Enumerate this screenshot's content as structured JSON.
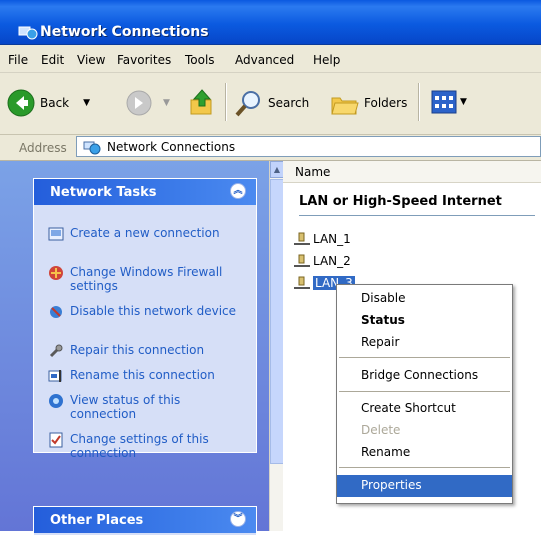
{
  "window": {
    "title": "Network Connections"
  },
  "menu": [
    "File",
    "Edit",
    "View",
    "Favorites",
    "Tools",
    "Advanced",
    "Help"
  ],
  "toolbar": {
    "back": "Back",
    "search": "Search",
    "folders": "Folders"
  },
  "address": {
    "label": "Address",
    "value": "Network Connections"
  },
  "tasks_panel": {
    "title": "Network Tasks",
    "items": [
      {
        "label": "Create a new connection",
        "icon": "new-connection-icon"
      },
      {
        "label": "Change Windows Firewall settings",
        "icon": "firewall-icon"
      },
      {
        "label": "Disable this network device",
        "icon": "disable-device-icon"
      },
      {
        "label": "Repair this connection",
        "icon": "repair-icon"
      },
      {
        "label": "Rename this connection",
        "icon": "rename-icon"
      },
      {
        "label": "View status of this connection",
        "icon": "status-icon"
      },
      {
        "label": "Change settings of this connection",
        "icon": "settings-icon"
      }
    ]
  },
  "places_panel": {
    "title": "Other Places"
  },
  "content": {
    "column_name": "Name",
    "group_title": "LAN or High-Speed Internet",
    "items": [
      {
        "label": "LAN_1",
        "selected": false
      },
      {
        "label": "LAN_2",
        "selected": false
      },
      {
        "label": "LAN_3",
        "selected": true
      }
    ]
  },
  "context_menu": {
    "disable": "Disable",
    "status": "Status",
    "repair": "Repair",
    "bridge": "Bridge Connections",
    "shortcut": "Create Shortcut",
    "delete": "Delete",
    "rename": "Rename",
    "properties": "Properties"
  },
  "colors": {
    "accent": "#316ac5",
    "titlebar": "#0a58e0",
    "task_link": "#215dc6"
  }
}
